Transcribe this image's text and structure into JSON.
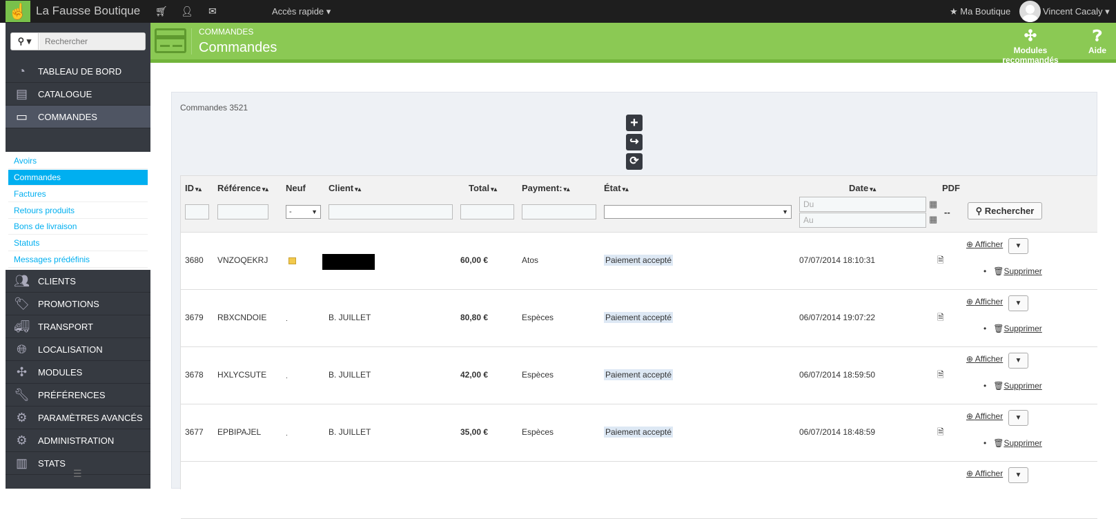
{
  "topbar": {
    "brand": "La Fausse Boutique",
    "quick_access": "Accès rapide ▾",
    "my_shop": "★ Ma Boutique",
    "user": "Vincent Cacaly ▾"
  },
  "sidebar": {
    "search_placeholder": "Rechercher",
    "items": [
      {
        "label": "TABLEAU DE BORD",
        "icon": "dashboard-icon"
      },
      {
        "label": "CATALOGUE",
        "icon": "book-icon"
      },
      {
        "label": "COMMANDES",
        "icon": "credit-card-icon"
      },
      {
        "label": "CLIENTS",
        "icon": "users-icon"
      },
      {
        "label": "PROMOTIONS",
        "icon": "tags-icon"
      },
      {
        "label": "TRANSPORT",
        "icon": "truck-icon"
      },
      {
        "label": "LOCALISATION",
        "icon": "globe-icon"
      },
      {
        "label": "MODULES",
        "icon": "puzzle-icon"
      },
      {
        "label": "PRÉFÉRENCES",
        "icon": "wrench-icon"
      },
      {
        "label": "PARAMÈTRES AVANCÉS",
        "icon": "cogs-icon"
      },
      {
        "label": "ADMINISTRATION",
        "icon": "gear-icon"
      },
      {
        "label": "STATS",
        "icon": "bar-chart-icon"
      }
    ],
    "submenu": [
      "Avoirs",
      "Commandes",
      "Factures",
      "Retours produits",
      "Bons de livraison",
      "Statuts",
      "Messages prédéfinis"
    ]
  },
  "page_header": {
    "breadcrumb": "COMMANDES",
    "title": "Commandes",
    "btn_modules": "Modules recommandés",
    "btn_help": "Aide"
  },
  "panel": {
    "title": "Commandes",
    "count": "3521"
  },
  "table": {
    "headers": {
      "id": "ID",
      "reference": "Référence",
      "new": "Neuf",
      "client": "Client",
      "total": "Total",
      "payment": "Payment:",
      "state": "État",
      "date": "Date",
      "pdf": "PDF"
    },
    "filters": {
      "new_select": "-",
      "date_from": "Du",
      "date_to": "Au",
      "pdf_placeholder": "--",
      "search_button": "Rechercher"
    },
    "actions": {
      "view": "Afficher",
      "delete": "Supprimer"
    },
    "rows": [
      {
        "id": "3680",
        "reference": "VNZOQEKRJ",
        "client": "",
        "total": "60,00 €",
        "payment": "Atos",
        "state": "Paiement accepté",
        "date": "07/07/2014 18:10:31"
      },
      {
        "id": "3679",
        "reference": "RBXCNDOIE",
        "client": "B. JUILLET",
        "total": "80,80 €",
        "payment": "Espèces",
        "state": "Paiement accepté",
        "date": "06/07/2014 19:07:22"
      },
      {
        "id": "3678",
        "reference": "HXLYCSUTE",
        "client": "B. JUILLET",
        "total": "42,00 €",
        "payment": "Espèces",
        "state": "Paiement accepté",
        "date": "06/07/2014 18:59:50"
      },
      {
        "id": "3677",
        "reference": "EPBIPAJEL",
        "client": "B. JUILLET",
        "total": "35,00 €",
        "payment": "Espèces",
        "state": "Paiement accepté",
        "date": "06/07/2014 18:48:59"
      }
    ]
  }
}
